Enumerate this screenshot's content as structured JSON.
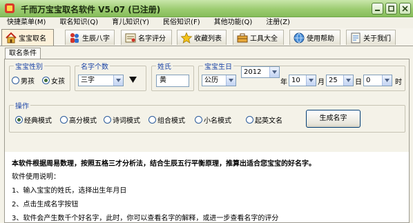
{
  "window": {
    "title": "千而万宝宝取名软件 V5.07 (已注册)"
  },
  "menu": [
    {
      "label": "快捷菜单(M)"
    },
    {
      "label": "取名知识(Q)"
    },
    {
      "label": "育儿知识(Y)"
    },
    {
      "label": "民俗知识(F)"
    },
    {
      "label": "其他功能(Q)"
    },
    {
      "label": "注册(Z)"
    }
  ],
  "tabs": [
    {
      "label": "宝宝取名",
      "icon": "home-icon"
    },
    {
      "label": "生辰八字",
      "icon": "people-icon"
    },
    {
      "label": "名字评分",
      "icon": "certificate-icon"
    },
    {
      "label": "收藏列表",
      "icon": "star-icon"
    },
    {
      "label": "工具大全",
      "icon": "toolbox-icon"
    },
    {
      "label": "使用帮助",
      "icon": "help-globe-icon"
    },
    {
      "label": "关于我们",
      "icon": "about-icon"
    }
  ],
  "subtab": {
    "label": "取名条件"
  },
  "gender": {
    "title": "宝宝性别",
    "options": [
      "男孩",
      "女孩"
    ],
    "selected": "女孩"
  },
  "name_length": {
    "title": "名字个数",
    "value": "三字"
  },
  "surname": {
    "title": "姓氏",
    "value": "黄"
  },
  "birth": {
    "title": "宝宝生日",
    "calendar": "公历",
    "year": "2012",
    "year_unit": "年",
    "month": "10",
    "month_unit": "月",
    "day": "25",
    "day_unit": "日",
    "hour": "0",
    "hour_unit": "时"
  },
  "operation": {
    "title": "操作",
    "modes": [
      "经典模式",
      "高分模式",
      "诗词模式",
      "组合模式",
      "小名模式",
      "起英文名"
    ],
    "selected": "经典模式",
    "generate_label": "生成名字"
  },
  "description": {
    "intro": "本软件根据周易数理，按照五格三才分析法，结合生辰五行平衡原理，推算出适合您宝宝的好名字。",
    "usage_title": "软件使用说明：",
    "steps": [
      "1、输入宝宝的姓氏，选择出生年月日",
      "2、点击生成名字按钮",
      "3、软件会产生数千个好名字，此时，你可以查看名字的解释，或进一步查看名字的评分"
    ]
  }
}
